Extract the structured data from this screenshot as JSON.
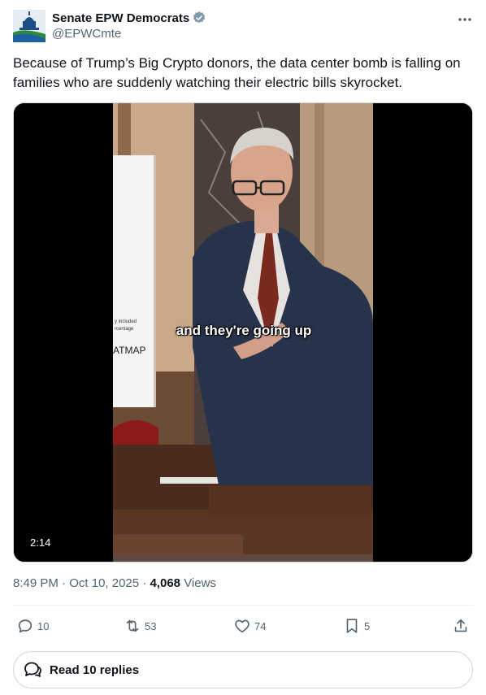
{
  "author": {
    "display_name": "Senate EPW Democrats",
    "handle": "@EPWCmte",
    "verified": true
  },
  "tweet": {
    "text": "Because of Trump’s Big Crypto donors, the data center bomb is falling on families who are suddenly watching their electric bills skyrocket."
  },
  "media": {
    "caption": "and they're going up",
    "duration": "2:14",
    "sign_text": "ATMAP",
    "sign_small_1": "y included",
    "sign_small_2": "rcentage"
  },
  "meta": {
    "time": "8:49 PM",
    "date": "Oct 10, 2025",
    "views_count": "4,068",
    "views_label": "Views"
  },
  "actions": {
    "replies": "10",
    "reposts": "53",
    "likes": "74",
    "bookmarks": "5"
  },
  "read_replies_label": "Read 10 replies",
  "colors": {
    "text": "#0f1419",
    "secondary": "#536471",
    "verified_badge": "#829aab",
    "border": "#cfd9de"
  }
}
